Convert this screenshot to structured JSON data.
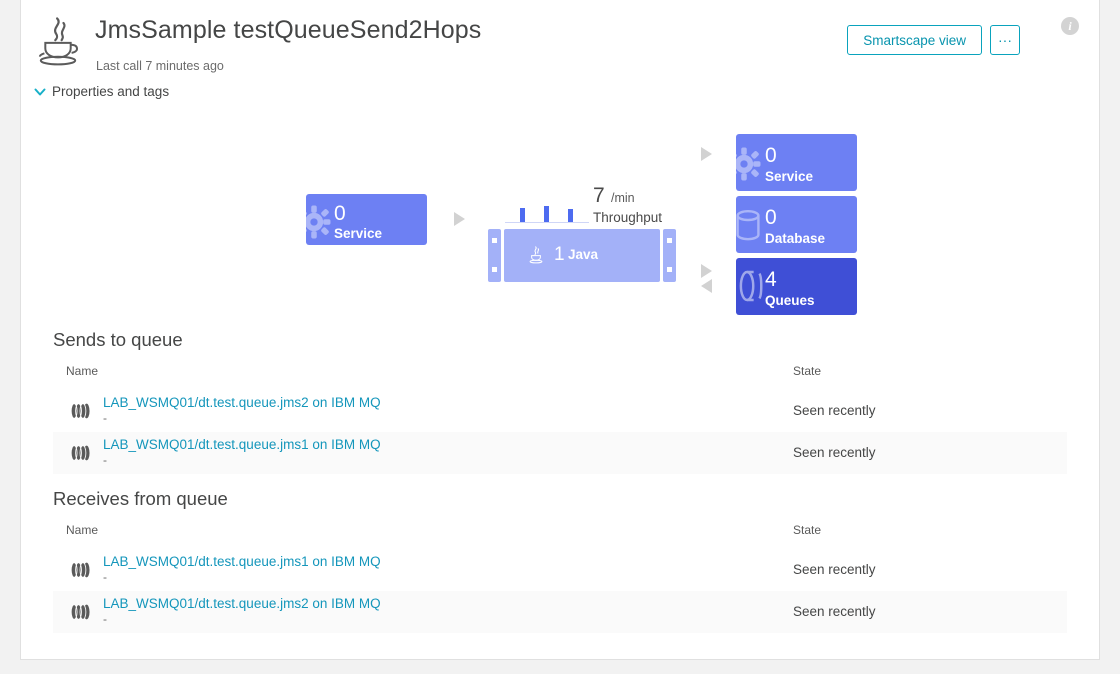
{
  "header": {
    "title": "JmsSample testQueueSend2Hops",
    "subtitle": "Last call 7 minutes ago",
    "logo_icon": "java-logo-icon",
    "smartscape_label": "Smartscape view",
    "more_label": "···",
    "info_label": "i"
  },
  "properties": {
    "label": "Properties and tags",
    "chevron": "❯"
  },
  "diagram": {
    "service_left": {
      "count": "0",
      "label": "Service",
      "color": "#6d80f3",
      "icon": "gear-icon"
    },
    "process_group": {
      "count": "1",
      "label": "Java",
      "color": "#a3b1f8",
      "icon": "java-logo-icon"
    },
    "throughput": {
      "value": "7",
      "unit": "/min",
      "label": "Throughput",
      "sparkline": [
        14,
        16,
        13
      ]
    },
    "service_right": {
      "count": "0",
      "label": "Service",
      "color": "#6d80f3",
      "icon": "gear-icon"
    },
    "database": {
      "count": "0",
      "label": "Database",
      "color": "#6d80f3",
      "icon": "database-icon"
    },
    "queues": {
      "count": "4",
      "label": "Queues",
      "color": "#3f4fd6",
      "icon": "queue-icon"
    }
  },
  "sends_section": {
    "title": "Sends to queue",
    "columns": {
      "name": "Name",
      "state": "State"
    },
    "rows": [
      {
        "name": "LAB_WSMQ01/dt.test.queue.jms2 on IBM MQ",
        "sub": "-",
        "state": "Seen recently",
        "icon": "queue-icon"
      },
      {
        "name": "LAB_WSMQ01/dt.test.queue.jms1 on IBM MQ",
        "sub": "-",
        "state": "Seen recently",
        "icon": "queue-icon"
      }
    ]
  },
  "receives_section": {
    "title": "Receives from queue",
    "columns": {
      "name": "Name",
      "state": "State"
    },
    "rows": [
      {
        "name": "LAB_WSMQ01/dt.test.queue.jms1 on IBM MQ",
        "sub": "-",
        "state": "Seen recently",
        "icon": "queue-icon"
      },
      {
        "name": "LAB_WSMQ01/dt.test.queue.jms2 on IBM MQ",
        "sub": "-",
        "state": "Seen recently",
        "icon": "queue-icon"
      }
    ]
  },
  "colors": {
    "accent": "#0894ae",
    "link": "#1496bb",
    "node_blue": "#6d80f3",
    "node_blue_dark": "#3f4fd6",
    "node_blue_light": "#a3b1f8"
  }
}
